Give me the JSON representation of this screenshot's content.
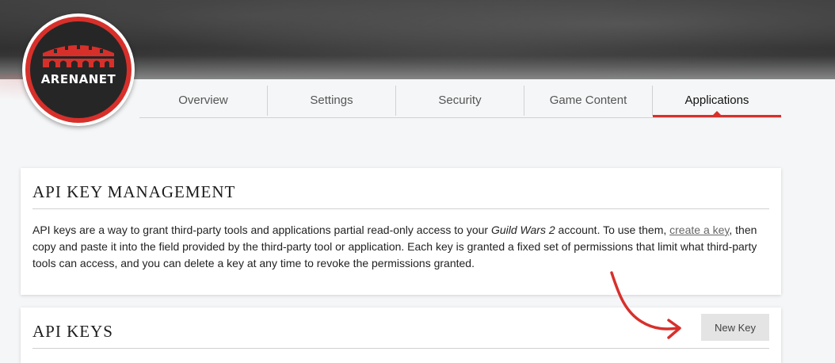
{
  "logo": {
    "text": "ARENANET",
    "colors": {
      "ring": "#d7302b",
      "inner": "#262626"
    }
  },
  "tabs": [
    {
      "label": "Overview",
      "active": false
    },
    {
      "label": "Settings",
      "active": false
    },
    {
      "label": "Security",
      "active": false
    },
    {
      "label": "Game Content",
      "active": false
    },
    {
      "label": "Applications",
      "active": true
    }
  ],
  "api_management": {
    "title": "API KEY MANAGEMENT",
    "text_1": "API keys are a way to grant third-party tools and applications partial read-only access to your ",
    "game_name": "Guild Wars 2",
    "text_2": " account. To use them, ",
    "link_label": "create a key",
    "text_3": ", then copy and paste it into the field provided by the third-party tool or application. Each key is granted a fixed set of permissions that limit what third-party tools can access, and you can delete a key at any time to revoke the permissions granted."
  },
  "api_keys": {
    "title": "API KEYS",
    "new_key_label": "New Key"
  },
  "colors": {
    "accent": "#d7302b",
    "background": "#f5f6f7"
  },
  "icons": {
    "arrow": "curved-arrow-icon"
  }
}
